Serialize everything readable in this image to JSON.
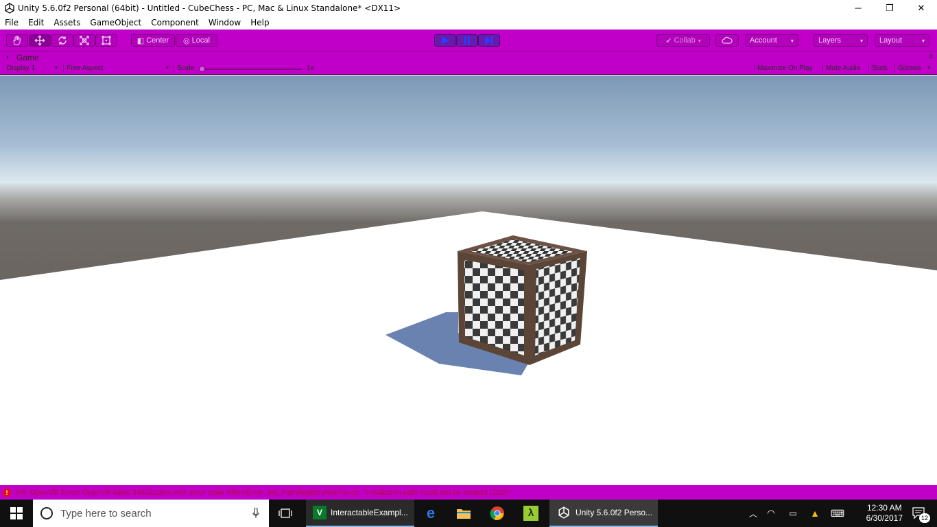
{
  "window": {
    "title": "Unity 5.6.0f2 Personal (64bit) - Untitled - CubeChess - PC, Mac & Linux Standalone* <DX11>",
    "minimize": "─",
    "restore": "❐",
    "close": "✕"
  },
  "menu": [
    "File",
    "Edit",
    "Assets",
    "GameObject",
    "Component",
    "Window",
    "Help"
  ],
  "toolbar": {
    "pivot": "Center",
    "space": "Local",
    "collab": "Collab",
    "account": "Account",
    "layers": "Layers",
    "layout": "Layout"
  },
  "game_view": {
    "tab": "Game",
    "display": "Display 1",
    "aspect": "Free Aspect",
    "scale_label": "Scale",
    "scale_value": "1x",
    "scale_level": 0.0,
    "maximize": "Maximize On Play",
    "mute": "Mute Audio",
    "stats": "Stats",
    "gizmos": "Gizmos"
  },
  "console": {
    "error_icon": "!",
    "message": "VR: OpenVR Error! OpenVR failed initialization with error code VRInitError_Init_PathRegistryNotFound: \"Installation path could not be located (110)\"!"
  },
  "taskbar": {
    "search_placeholder": "Type here to search",
    "app1": "InteractableExampl...",
    "app2": "Unity 5.6.0f2 Perso...",
    "time": "12:30 AM",
    "date": "6/30/2017",
    "notification_count": "12"
  },
  "colors": {
    "editor_tint": "#c000c8",
    "play_active": "#6a1aa8",
    "error_text": "#b01030"
  }
}
